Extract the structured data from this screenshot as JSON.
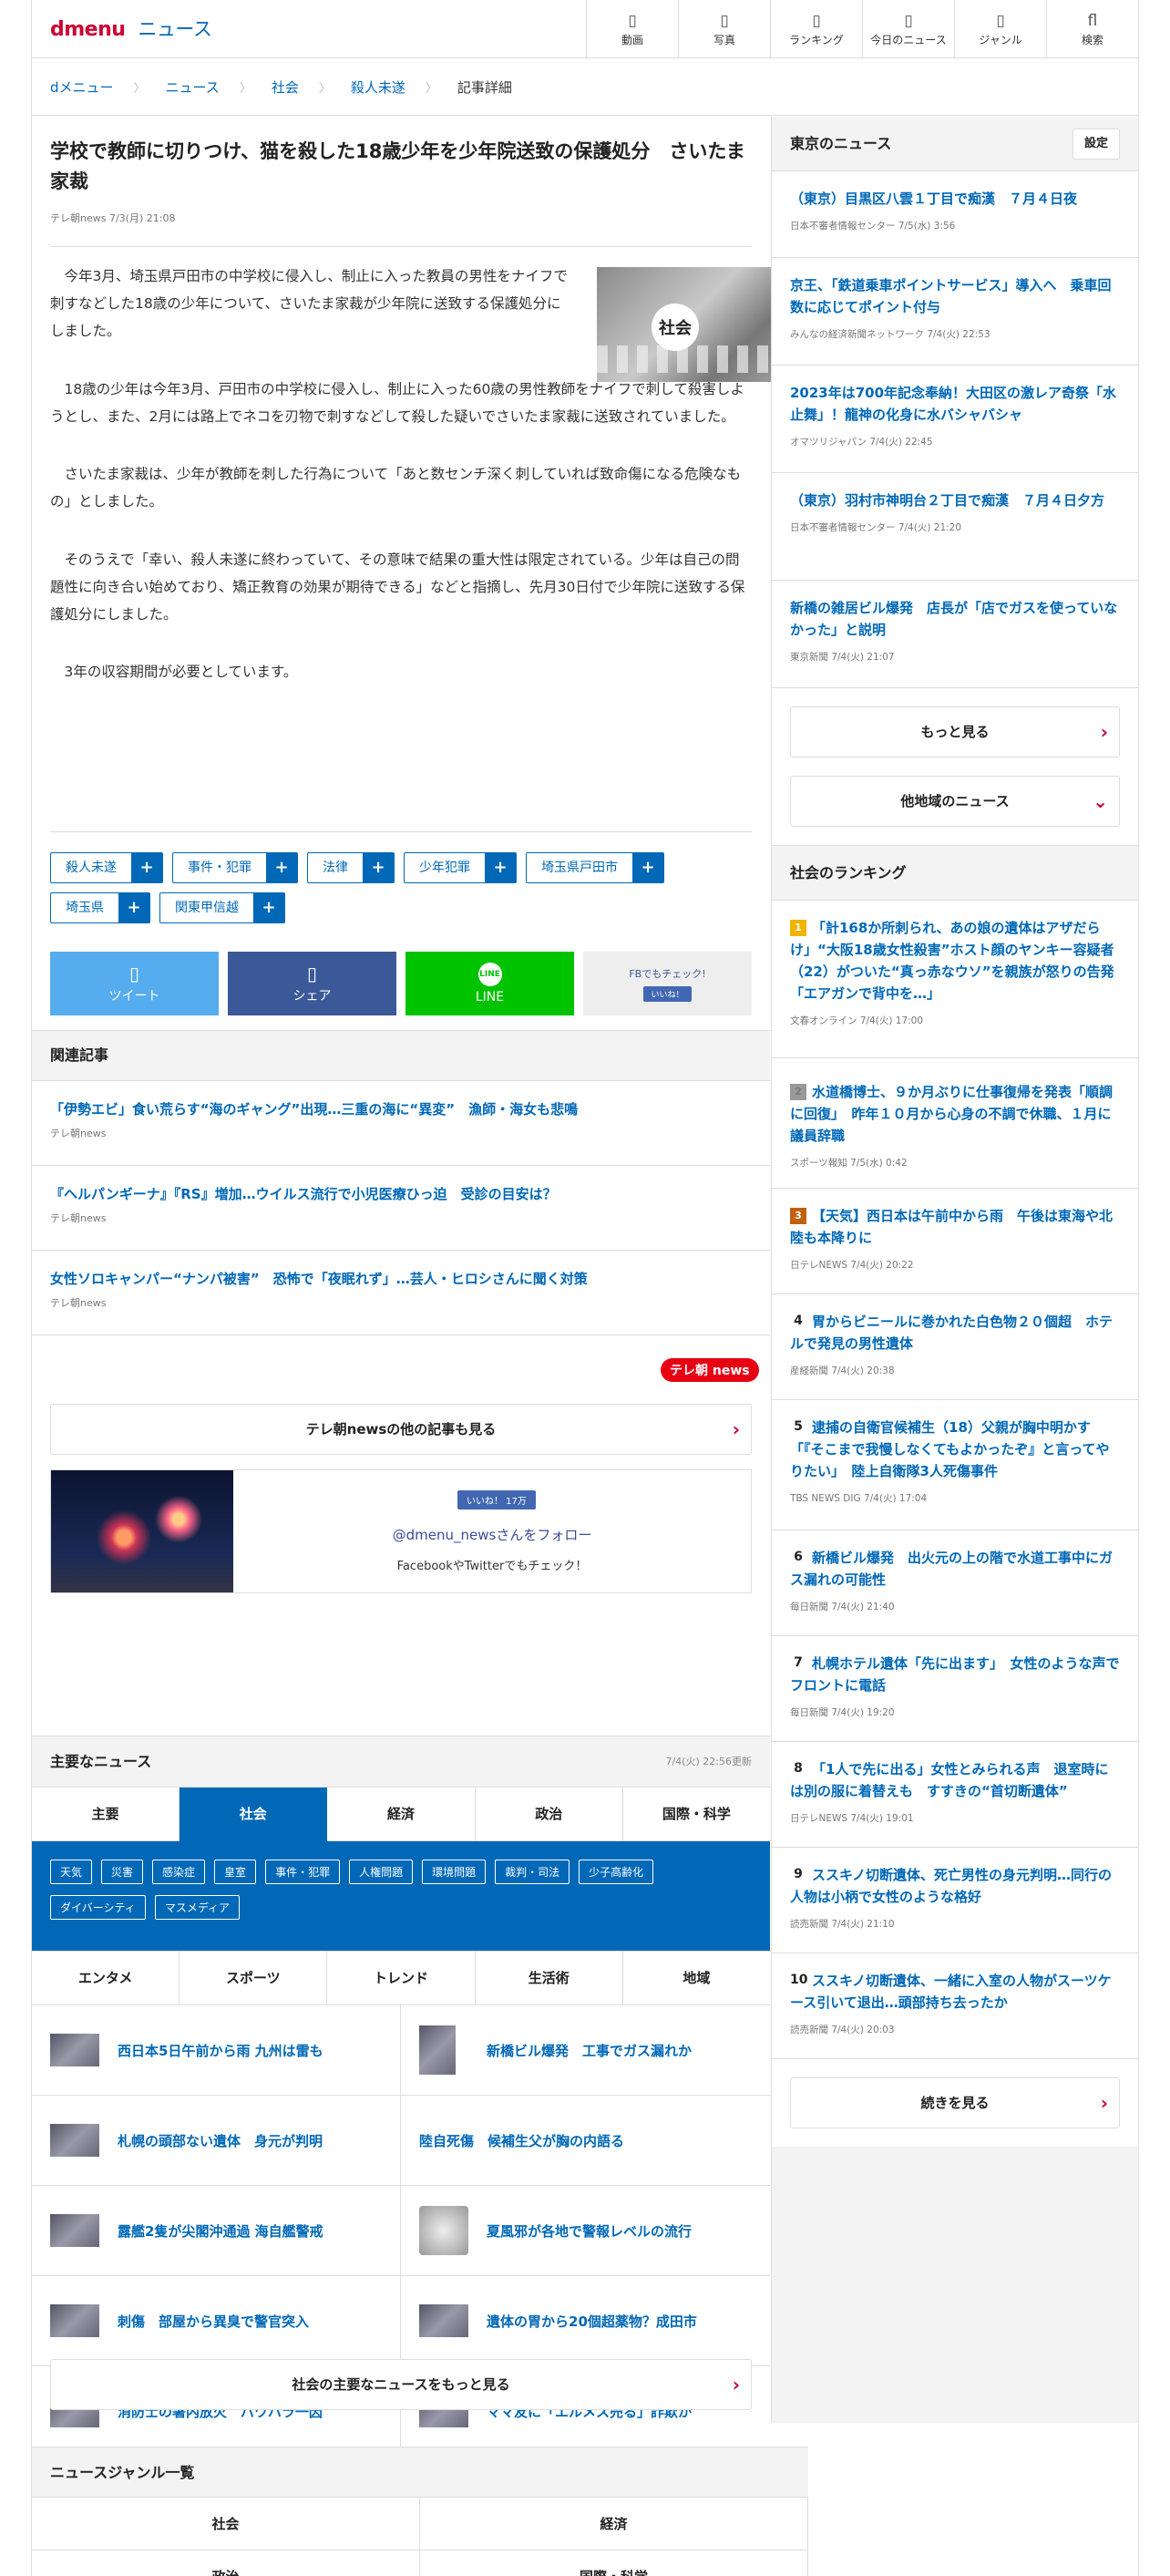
{
  "header": {
    "logo": "dmenu",
    "section": "ニュース",
    "nav": [
      {
        "icon": "video-icon",
        "glyph": "▯",
        "label": "動画"
      },
      {
        "icon": "photo-icon",
        "glyph": "▯",
        "label": "写真"
      },
      {
        "icon": "ranking-icon",
        "glyph": "▯",
        "label": "ランキング"
      },
      {
        "icon": "today-icon",
        "glyph": "▯",
        "label": "今日のニュース"
      },
      {
        "icon": "genre-icon",
        "glyph": "▯",
        "label": "ジャンル"
      },
      {
        "icon": "search-icon",
        "glyph": "fl",
        "label": "検索"
      }
    ]
  },
  "breadcrumb": [
    "dメニュー",
    "ニュース",
    "社会",
    "殺人未遂",
    "記事詳細"
  ],
  "article": {
    "title": "学校で教師に切りつけ、猫を殺した18歳少年を少年院送致の保護処分　さいたま家裁",
    "source": "テレ朝news 7/3(月) 21:08",
    "thumb_label": "社会",
    "paragraphs": [
      "今年3月、埼玉県戸田市の中学校に侵入し、制止に入った教員の男性をナイフで刺すなどした18歳の少年について、さいたま家裁が少年院に送致する保護処分にしました。",
      "18歳の少年は今年3月、戸田市の中学校に侵入し、制止に入った60歳の男性教師をナイフで刺して殺害しようとし、また、2月には路上でネコを刃物で刺すなどして殺した疑いでさいたま家裁に送致されていました。",
      "さいたま家裁は、少年が教師を刺した行為について「あと数センチ深く刺していれば致命傷になる危険なもの」としました。",
      "そのうえで「幸い、殺人未遂に終わっていて、その意味で結果の重大性は限定されている。少年は自己の問題性に向き合い始めており、矯正教育の効果が期待できる」などと指摘し、先月30日付で少年院に送致する保護処分にしました。",
      "3年の収容期間が必要としています。"
    ],
    "tags": [
      "殺人未遂",
      "事件・犯罪",
      "法律",
      "少年犯罪",
      "埼玉県戸田市",
      "埼玉県",
      "関東甲信越"
    ],
    "tag_plus": "+",
    "share": {
      "tweet": "ツイート",
      "share": "シェア",
      "line": "LINE",
      "line_badge": "LINE",
      "fb_check": "FBでもチェック!",
      "like": "いいね！"
    }
  },
  "related": {
    "title": "関連記事",
    "items": [
      {
        "title": "「伊勢エビ」食い荒らす“海のギャング”出現…三重の海に“異変”　漁師・海女も悲鳴",
        "source": "テレ朝news"
      },
      {
        "title": "『ヘルパンギーナ』『RS』増加…ウイルス流行で小児医療ひっ迫　受診の目安は？",
        "source": "テレ朝news"
      },
      {
        "title": "女性ソロキャンパー“ナンパ被害”　恐怖で「夜眠れず」…芸人・ヒロシさんに聞く対策",
        "source": "テレ朝news"
      }
    ],
    "provider_logo": "テレ朝 news",
    "more": "テレ朝newsの他の記事も見る",
    "follow_like": "いいね！ 17万",
    "follow": "@dmenu_newsさんをフォロー",
    "follow_sub": "FacebookやTwitterでもチェック！"
  },
  "major": {
    "title": "主要なニュース",
    "updated": "7/4(火) 22:56更新",
    "tabs1": [
      "主要",
      "社会",
      "経済",
      "政治",
      "国際・科学"
    ],
    "active_tab": "社会",
    "subtags": [
      "天気",
      "災害",
      "感染症",
      "皇室",
      "事件・犯罪",
      "人権問題",
      "環境問題",
      "裁判・司法",
      "少子高齢化",
      "ダイバーシティ",
      "マスメディア"
    ],
    "tabs2": [
      "エンタメ",
      "スポーツ",
      "トレンド",
      "生活術",
      "地域"
    ],
    "items": [
      [
        "西日本5日午前から雨 九州は雷も",
        "新橋ビル爆発　工事でガス漏れか"
      ],
      [
        "札幌の頭部ない遺体　身元が判明",
        "陸自死傷　候補生父が胸の内語る"
      ],
      [
        "露艦2隻が尖閣沖通過 海自艦警戒",
        "夏風邪が各地で警報レベルの流行"
      ],
      [
        "刺傷　部屋から異臭で警官突入",
        "遺体の胃から20個超薬物？成田市"
      ],
      [
        "消防士の署内放火　パワハラ一因",
        "ママ友に「エルメス売る」詐欺か"
      ]
    ],
    "more": "社会の主要なニュースをもっと見る"
  },
  "genre": {
    "title": "ニュースジャンル一覧",
    "rows": [
      [
        "社会",
        "経済"
      ],
      [
        "政治",
        "国際・科学"
      ]
    ]
  },
  "tokyo": {
    "title": "東京のニュース",
    "settings": "設定",
    "items": [
      {
        "title": "（東京）目黒区八雲１丁目で痴漢　７月４日夜",
        "source": "日本不審者情報センター 7/5(水) 3:56"
      },
      {
        "title": "京王、「鉄道乗車ポイントサービス」導入へ　乗車回数に応じてポイント付与",
        "source": "みんなの経済新聞ネットワーク 7/4(火) 22:53"
      },
      {
        "title": "2023年は700年記念奉納！大田区の激レア奇祭「水止舞」！龍神の化身に水バシャバシャ",
        "source": "オマツリジャパン 7/4(火) 22:45"
      },
      {
        "title": "（東京）羽村市神明台２丁目で痴漢　７月４日夕方",
        "source": "日本不審者情報センター 7/4(火) 21:20"
      },
      {
        "title": "新橋の雑居ビル爆発　店長が「店でガスを使っていなかった」と説明",
        "source": "東京新聞 7/4(火) 21:07"
      }
    ],
    "more": "もっと見る",
    "other": "他地域のニュース"
  },
  "ranking": {
    "title": "社会のランキング",
    "items": [
      {
        "n": "1",
        "title": "「計168か所刺られ、あの娘の遺体はアザだらけ」“大阪18歳女性殺害”ホスト顔のヤンキー容疑者（22）がついた“真っ赤なウソ”を親族が怒りの告発「エアガンで背中を…」",
        "source": "文春オンライン 7/4(火) 17:00"
      },
      {
        "n": "2",
        "title": "水道橋博士、９か月ぶりに仕事復帰を発表「順調に回復」　昨年１０月から心身の不調で休職、１月に議員辞職",
        "source": "スポーツ報知 7/5(水) 0:42"
      },
      {
        "n": "3",
        "title": "【天気】西日本は午前中から雨　午後は東海や北陸も本降りに",
        "source": "日テレNEWS 7/4(火) 20:22"
      },
      {
        "n": "4",
        "title": "胃からビニールに巻かれた白色物２０個超　ホテルで発見の男性遺体",
        "source": "産経新聞 7/4(火) 20:38"
      },
      {
        "n": "5",
        "title": "逮捕の自衛官候補生（18）父親が胸中明かす「『そこまで我慢しなくてもよかったぞ』と言ってやりたい」　陸上自衛隊3人死傷事件",
        "source": "TBS NEWS DIG 7/4(火) 17:04"
      },
      {
        "n": "6",
        "title": "新橋ビル爆発　出火元の上の階で水道工事中にガス漏れの可能性",
        "source": "毎日新聞 7/4(火) 21:40"
      },
      {
        "n": "7",
        "title": "札幌ホテル遺体「先に出ます」　女性のような声でフロントに電話",
        "source": "毎日新聞 7/4(火) 19:20"
      },
      {
        "n": "8",
        "title": "「1人で先に出る」女性とみられる声　退室時には別の服に着替えも　すすきの“首切断遺体”",
        "source": "日テレNEWS 7/4(火) 19:01"
      },
      {
        "n": "9",
        "title": "ススキノ切断遺体、死亡男性の身元判明…同行の人物は小柄で女性のような格好",
        "source": "読売新聞 7/4(火) 21:10"
      },
      {
        "n": "10",
        "title": "ススキノ切断遺体、一緒に入室の人物がスーツケース引いて退出…頭部持ち去ったか",
        "source": "読売新聞 7/4(火) 20:03"
      }
    ],
    "more": "続きを見る"
  },
  "colors": {
    "accent": "#0068b7",
    "brand": "#cc0033",
    "twitter": "#55acee",
    "facebook": "#3b5998",
    "line": "#00c300"
  }
}
